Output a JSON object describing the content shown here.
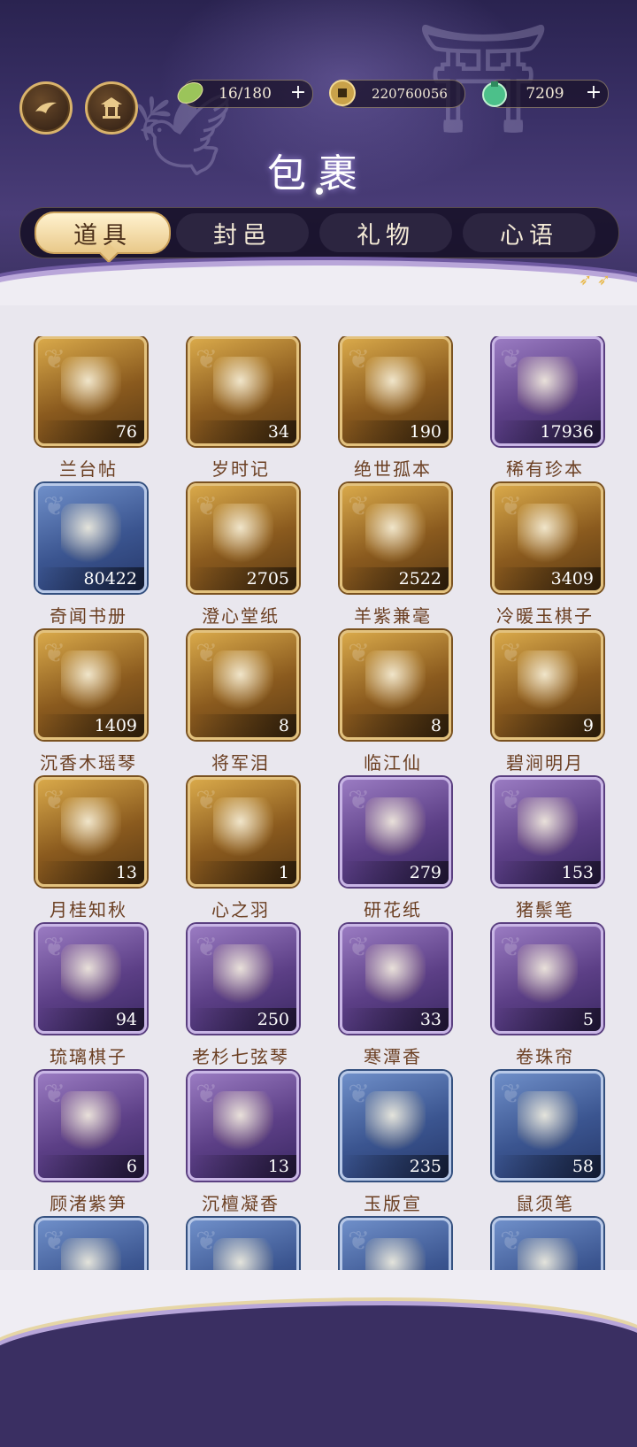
{
  "header": {
    "title": "包裹",
    "resources": [
      {
        "icon": "leaf-stamina-icon",
        "value": "16/180",
        "has_plus": true
      },
      {
        "icon": "copper-coin-icon",
        "value": "220760056",
        "has_plus": false
      },
      {
        "icon": "jade-pouch-icon",
        "value": "7209",
        "has_plus": true
      }
    ],
    "left_buttons": [
      "home-crane-icon",
      "pavilion-icon"
    ]
  },
  "tabs": [
    {
      "label": "道具",
      "active": true
    },
    {
      "label": "封邑",
      "active": false
    },
    {
      "label": "礼物",
      "active": false
    },
    {
      "label": "心语",
      "active": false
    }
  ],
  "items": [
    {
      "name": "兰台帖",
      "count": "76",
      "rarity": "gold"
    },
    {
      "name": "岁时记",
      "count": "34",
      "rarity": "gold"
    },
    {
      "name": "绝世孤本",
      "count": "190",
      "rarity": "gold"
    },
    {
      "name": "稀有珍本",
      "count": "17936",
      "rarity": "purple"
    },
    {
      "name": "奇闻书册",
      "count": "80422",
      "rarity": "blue"
    },
    {
      "name": "澄心堂纸",
      "count": "2705",
      "rarity": "gold"
    },
    {
      "name": "羊紫兼毫",
      "count": "2522",
      "rarity": "gold"
    },
    {
      "name": "冷暖玉棋子",
      "count": "3409",
      "rarity": "gold"
    },
    {
      "name": "沉香木瑶琴",
      "count": "1409",
      "rarity": "gold"
    },
    {
      "name": "将军泪",
      "count": "8",
      "rarity": "gold"
    },
    {
      "name": "临江仙",
      "count": "8",
      "rarity": "gold"
    },
    {
      "name": "碧涧明月",
      "count": "9",
      "rarity": "gold"
    },
    {
      "name": "月桂知秋",
      "count": "13",
      "rarity": "gold"
    },
    {
      "name": "心之羽",
      "count": "1",
      "rarity": "gold"
    },
    {
      "name": "研花纸",
      "count": "279",
      "rarity": "purple"
    },
    {
      "name": "猪鬃笔",
      "count": "153",
      "rarity": "purple"
    },
    {
      "name": "琉璃棋子",
      "count": "94",
      "rarity": "purple"
    },
    {
      "name": "老杉七弦琴",
      "count": "250",
      "rarity": "purple"
    },
    {
      "name": "寒潭香",
      "count": "33",
      "rarity": "purple"
    },
    {
      "name": "卷珠帘",
      "count": "5",
      "rarity": "purple"
    },
    {
      "name": "顾渚紫笋",
      "count": "6",
      "rarity": "purple"
    },
    {
      "name": "沉檀凝香",
      "count": "13",
      "rarity": "purple"
    },
    {
      "name": "玉版宣",
      "count": "235",
      "rarity": "blue"
    },
    {
      "name": "鼠须笔",
      "count": "58",
      "rarity": "blue"
    },
    {
      "name": "",
      "count": "",
      "rarity": "blue"
    },
    {
      "name": "",
      "count": "",
      "rarity": "blue"
    },
    {
      "name": "",
      "count": "",
      "rarity": "blue"
    },
    {
      "name": "",
      "count": "",
      "rarity": "blue"
    }
  ],
  "colors": {
    "gold": "#d9a94a",
    "purple": "#6a4a96",
    "blue": "#3b5590",
    "name_text": "#6b3f22"
  }
}
